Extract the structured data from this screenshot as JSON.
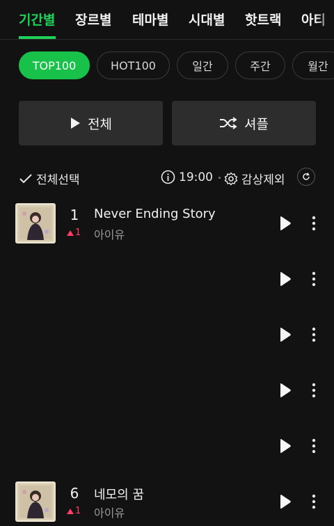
{
  "tabs": [
    "기간별",
    "장르별",
    "테마별",
    "시대별",
    "핫트랙",
    "아티"
  ],
  "chips": [
    "TOP100",
    "HOT100",
    "일간",
    "주간",
    "월간"
  ],
  "actions": {
    "play_all": "전체",
    "shuffle": "셔플"
  },
  "toolbar": {
    "select_all": "전체선택",
    "time": "19:00",
    "exclude": "감상제외"
  },
  "colors": {
    "accent": "#1fd15b",
    "chip_active": "#18c24a",
    "rank_up": "#ff3d66",
    "background": "#121212"
  },
  "songs": [
    {
      "rank": "1",
      "change": "1",
      "title": "Never Ending Story",
      "artist": "아이유"
    },
    {
      "rank": "6",
      "change": "1",
      "title": "네모의 꿈",
      "artist": "아이유"
    }
  ]
}
